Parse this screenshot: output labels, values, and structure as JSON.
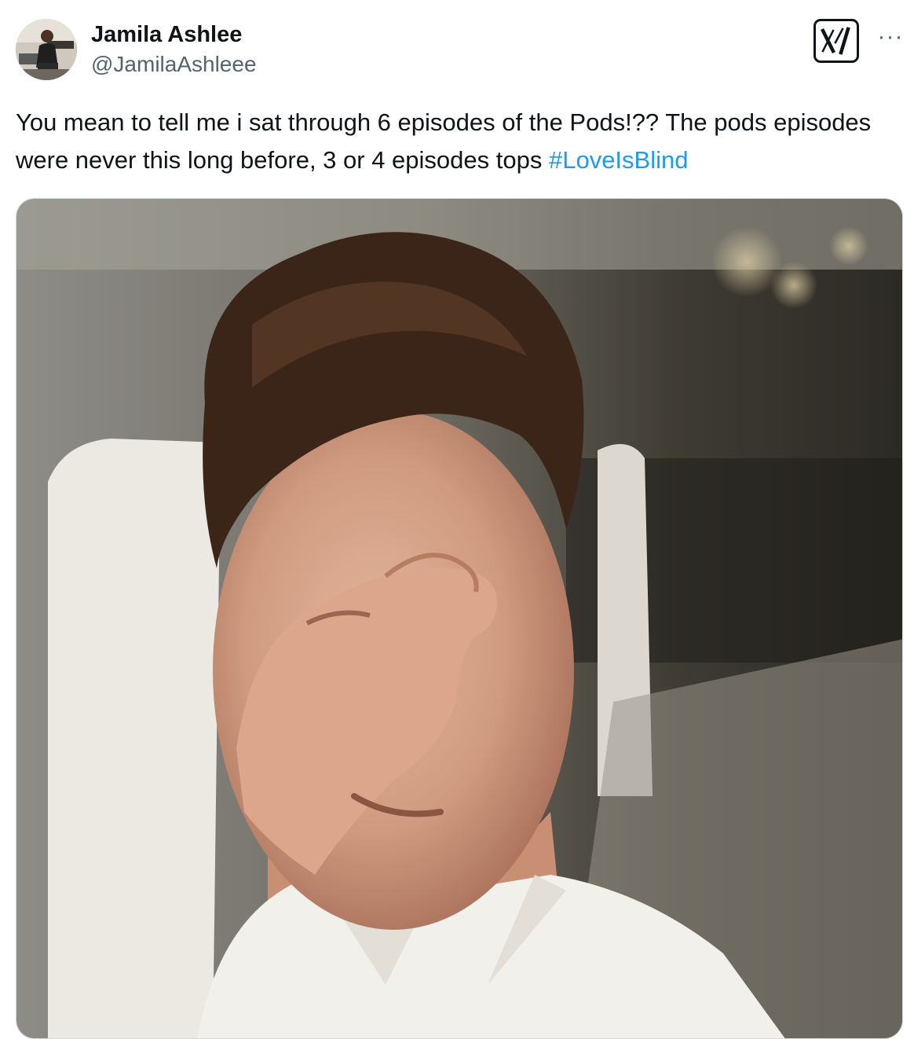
{
  "tweet": {
    "author": {
      "display_name": "Jamila Ashlee",
      "handle": "@JamilaAshleee",
      "avatar_icon": "user-avatar"
    },
    "brand_icon": "x-logo-icon",
    "more_label": "···",
    "text": {
      "body": "You mean to tell me i sat through 6 episodes of the Pods!?? The pods episodes were never this long before, 3 or 4 episodes tops ",
      "hashtag": "#LoveIsBlind"
    },
    "media": {
      "type": "image",
      "subject_icon": "photo"
    },
    "colors": {
      "text": "#0f1419",
      "secondary": "#536471",
      "link": "#1d9bf0",
      "border": "#cfd9de"
    }
  }
}
